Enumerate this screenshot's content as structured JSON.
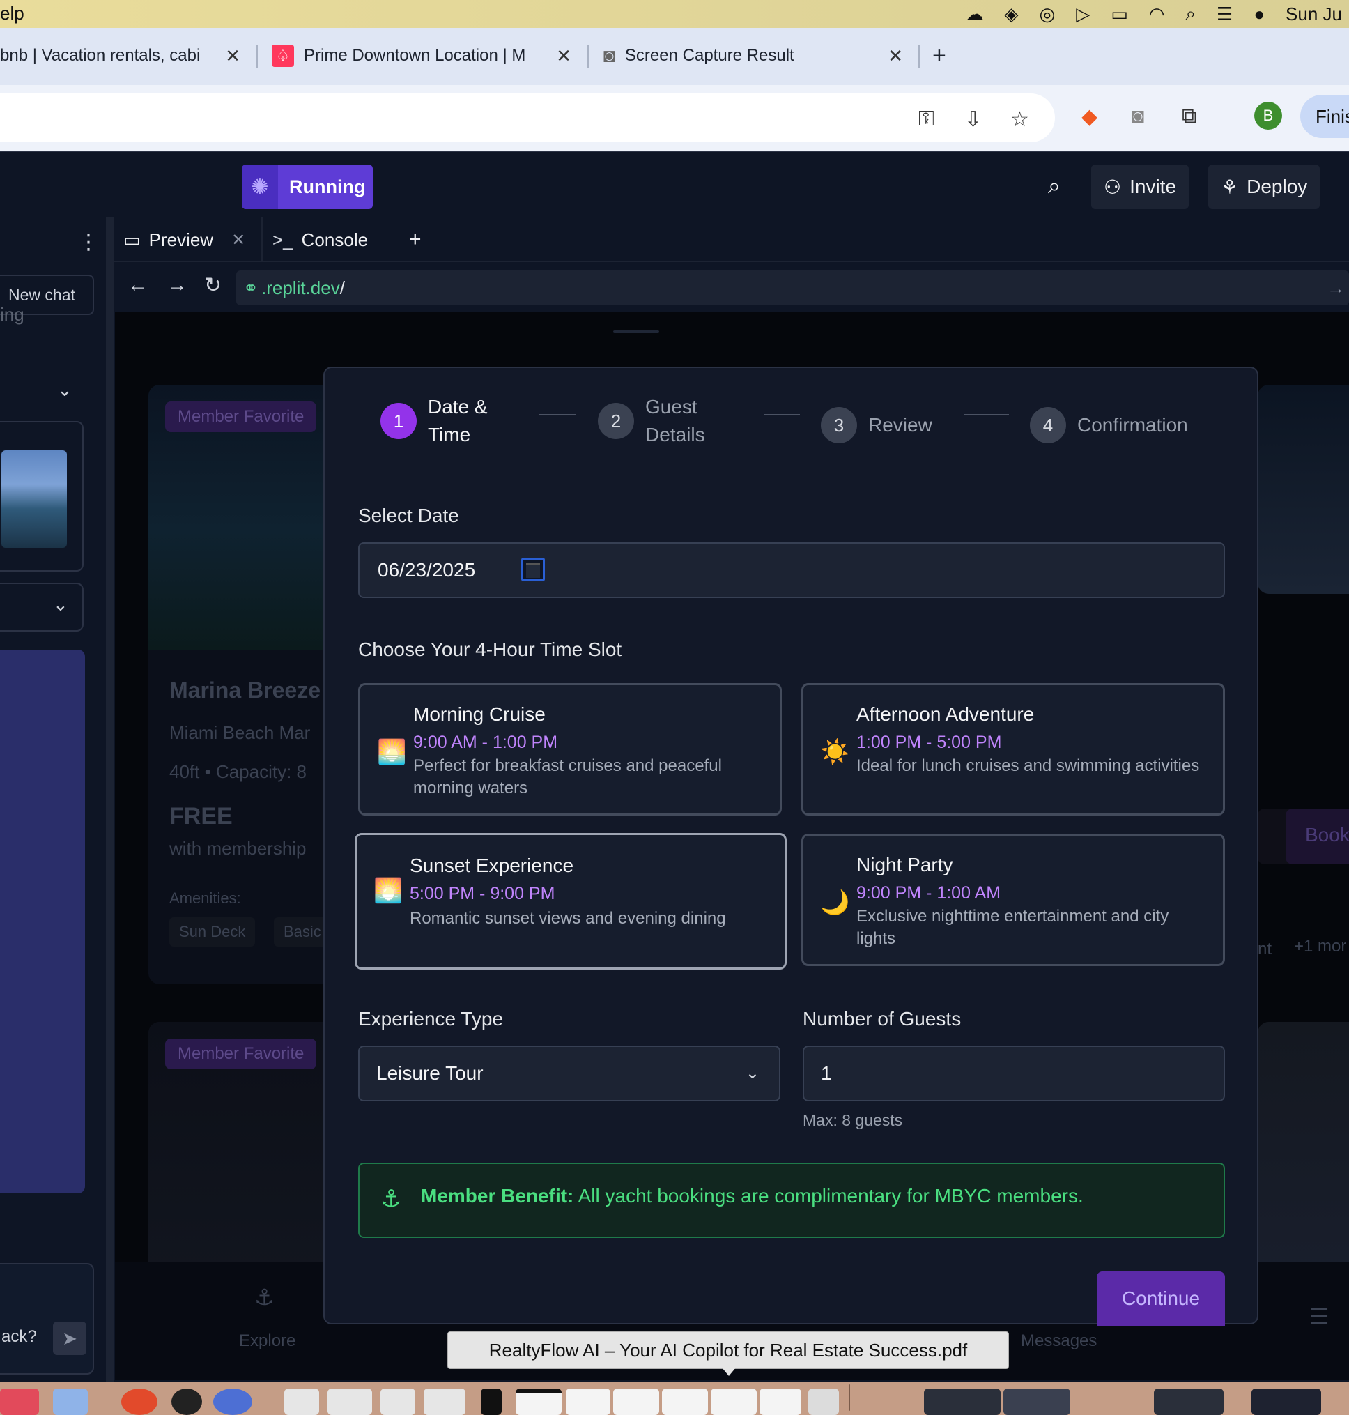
{
  "menubar": {
    "left_text": "elp",
    "right_text": "Sun Ju"
  },
  "browser_tabs": [
    {
      "label": "bnb | Vacation rentals, cabi",
      "close": "✕"
    },
    {
      "label": "Prime Downtown Location | M",
      "close": "✕"
    },
    {
      "label": "Screen Capture Result",
      "close": "✕"
    }
  ],
  "new_tab": "+",
  "toolbar": {
    "finish_label": "Finis",
    "profile_initial": "B"
  },
  "replit": {
    "run_label": "Running",
    "invite_label": "Invite",
    "deploy_label": "Deploy"
  },
  "sidebar": {
    "new_chat": "New chat",
    "partial_text": "ing",
    "chat_partial": "ack?"
  },
  "pane": {
    "preview_tab": "Preview",
    "console_tab": "Console",
    "url_domain": ".replit.dev",
    "url_path": "/"
  },
  "background_app": {
    "badge1": "Member Favorite",
    "badge2": "Member Favorite",
    "card_title": "Marina Breeze",
    "card_location": "Miami Beach Mar",
    "card_specs": "40ft • Capacity: 8",
    "card_price": "FREE",
    "card_price_sub": "with membership",
    "amenities_label": "Amenities:",
    "amenity1": "Sun Deck",
    "amenity2": "Basic",
    "right_book": "Book",
    "right_more": "+1 mor",
    "right_partial": "nt",
    "nav_explore": "Explore",
    "nav_messages": "Messages"
  },
  "modal": {
    "steps": [
      {
        "num": "1",
        "label_line1": "Date &",
        "label_line2": "Time"
      },
      {
        "num": "2",
        "label_line1": "Guest",
        "label_line2": "Details"
      },
      {
        "num": "3",
        "label_line1": "Review"
      },
      {
        "num": "4",
        "label_line1": "Confirmation"
      }
    ],
    "select_date_label": "Select Date",
    "date_value": "06/23/2025",
    "time_slot_label": "Choose Your 4-Hour Time Slot",
    "slots": [
      {
        "emoji": "🌅",
        "title": "Morning Cruise",
        "time": "9:00 AM - 1:00 PM",
        "desc": "Perfect for breakfast cruises and peaceful morning waters"
      },
      {
        "emoji": "☀️",
        "title": "Afternoon Adventure",
        "time": "1:00 PM - 5:00 PM",
        "desc": "Ideal for lunch cruises and swimming activities"
      },
      {
        "emoji": "🌅",
        "title": "Sunset Experience",
        "time": "5:00 PM - 9:00 PM",
        "desc": "Romantic sunset views and evening dining"
      },
      {
        "emoji": "🌙",
        "title": "Night Party",
        "time": "9:00 PM - 1:00 AM",
        "desc": "Exclusive nighttime entertainment and city lights"
      }
    ],
    "experience_label": "Experience Type",
    "experience_value": "Leisure Tour",
    "guests_label": "Number of Guests",
    "guests_value": "1",
    "max_guests": "Max: 8 guests",
    "benefit_bold": "Member Benefit:",
    "benefit_text": "All yacht bookings are complimentary for MBYC members.",
    "continue_label": "Continue"
  },
  "tooltip": "RealtyFlow AI – Your AI Copilot for Real Estate Success.pdf"
}
